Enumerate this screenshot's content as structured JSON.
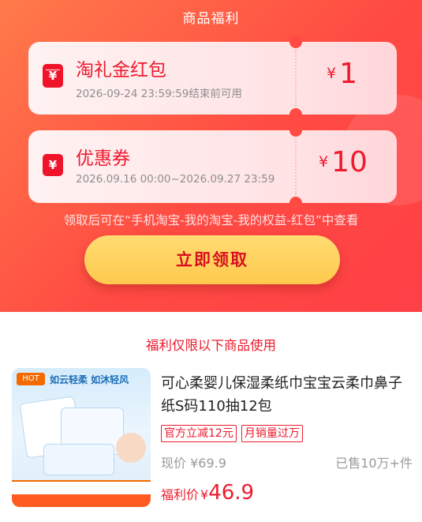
{
  "header": {
    "title": "商品福利"
  },
  "coupons": [
    {
      "name": "淘礼金红包",
      "valid": "2026-09-24 23:59:59结束前可用",
      "currency": "¥",
      "amount": "1",
      "icon": "red-packet-icon"
    },
    {
      "name": "优惠券",
      "valid": "2026.09.16 00:00~2026.09.27 23:59",
      "currency": "¥",
      "amount": "10",
      "icon": "coupon-ticket-icon"
    }
  ],
  "note": "领取后可在“手机淘宝-我的淘宝-我的权益-红包”中查看",
  "claim_button": "立即领取",
  "restriction": "福利仅限以下商品使用",
  "product": {
    "title": "可心柔婴儿保湿柔纸巾宝宝云柔巾鼻子纸S码110抽12包",
    "image_tag": "HOT",
    "image_slogan": "如云轻柔 如沐轻风",
    "badges": [
      "官方立减12元",
      "月销量过万"
    ],
    "price_label": "现价",
    "price_currency": "¥",
    "price": "69.9",
    "sold": "已售10万+件",
    "welfare_label": "福利价",
    "welfare_currency": "¥",
    "welfare_price": "46.9"
  },
  "colors": {
    "accent_red": "#ee1a2d",
    "header_gradient_start": "#ff7a4a",
    "header_gradient_end": "#ff3f46",
    "button_yellow": "#ffc94d"
  }
}
